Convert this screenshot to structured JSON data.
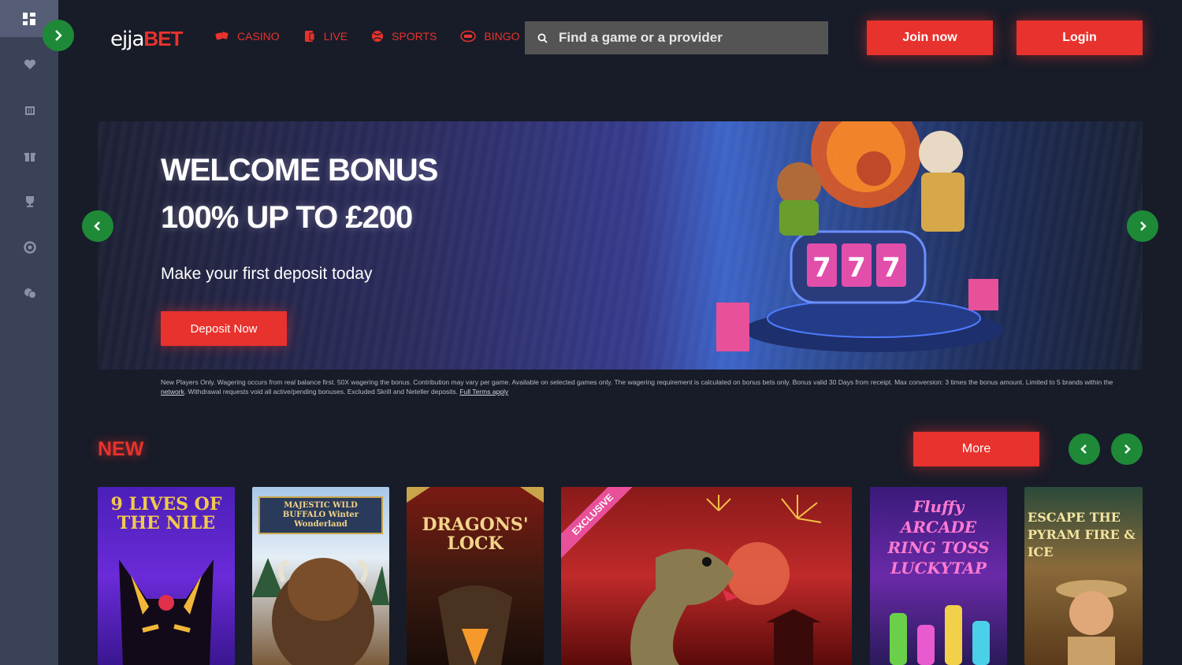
{
  "header": {
    "logo_part1": "ejja",
    "logo_part2": "BET",
    "nav": [
      {
        "label": "CASINO",
        "icon": "dice-icon"
      },
      {
        "label": "LIVE",
        "icon": "cards-icon"
      },
      {
        "label": "SPORTS",
        "icon": "ball-icon"
      },
      {
        "label": "BINGO",
        "icon": "bingo-icon"
      }
    ],
    "search_placeholder": "Find a game or a provider",
    "join_label": "Join now",
    "login_label": "Login"
  },
  "sidebar": {
    "items": [
      "grid-icon",
      "heart-icon",
      "bank-icon",
      "gift-icon",
      "trophy-icon",
      "support-icon",
      "chat-icon"
    ]
  },
  "banner": {
    "title_line1": "WELCOME BONUS",
    "title_line2": "100% UP TO £200",
    "subtitle": "Make your first deposit today",
    "cta_label": "Deposit Now",
    "terms_text": "New Players Only. Wagering occurs from real balance first. 50X wagering the bonus. Contribution may vary per game. Available on selected games only. The wagering requirement is calculated on bonus bets only. Bonus valid 30 Days from receipt. Max conversion: 3 times the bonus amount. Limited to 5 brands within the ",
    "terms_link1": "network",
    "terms_text2": ". Withdrawal requests void all active/pending bonuses. Excluded Skrill and Neteller deposits. ",
    "terms_link2": "Full Terms apply"
  },
  "new_section": {
    "title": "NEW",
    "more_label": "More",
    "games": [
      {
        "title": "9 LIVES OF THE NILE"
      },
      {
        "title": "MAJESTIC WILD BUFFALO Winter Wonderland"
      },
      {
        "title": "DRAGONS' LOCK"
      },
      {
        "title": "EXCLUSIVE"
      },
      {
        "title": "Fluffy ARCADE RING TOSS LUCKYTAP"
      },
      {
        "title": "ESCAPE THE PYRAM FIRE & ICE"
      }
    ]
  },
  "colors": {
    "accent": "#e8322d",
    "green": "#1e8a38",
    "sidebar": "#3a4258",
    "background": "#181c28"
  }
}
